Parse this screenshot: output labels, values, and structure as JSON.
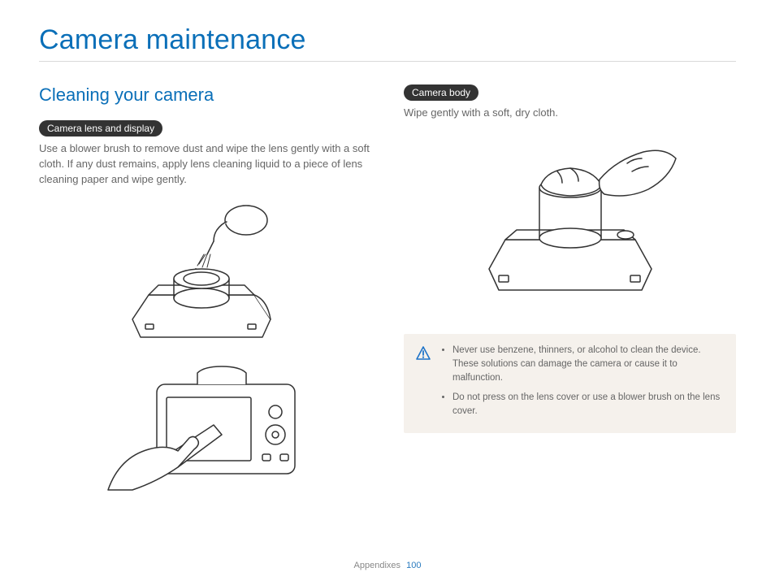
{
  "title": "Camera maintenance",
  "left": {
    "section": "Cleaning your camera",
    "pill": "Camera lens and display",
    "text": "Use a blower brush to remove dust and wipe the lens gently with a soft cloth. If any dust remains, apply lens cleaning liquid to a piece of lens cleaning paper and wipe gently."
  },
  "right": {
    "pill": "Camera body",
    "text": "Wipe gently with a soft, dry cloth.",
    "callout": {
      "items": [
        "Never use benzene, thinners, or alcohol to clean the device. These solutions can damage the camera or cause it to malfunction.",
        "Do not press on the lens cover or use a blower brush on the lens cover."
      ]
    }
  },
  "footer": {
    "section": "Appendixes",
    "page": "100"
  }
}
